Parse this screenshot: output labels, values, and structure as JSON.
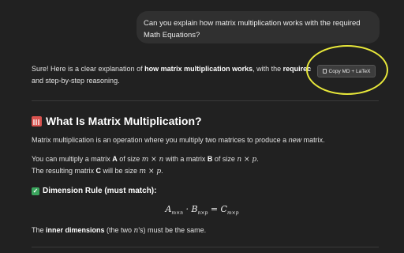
{
  "user_message": {
    "line1": "Can you explain how matrix multiplication works with the required",
    "line2": "Math Equations?"
  },
  "intro": {
    "pre": "Sure! Here is a clear explanation of ",
    "bold": "how matrix multiplication works",
    "mid": ", with the ",
    "bold2": "requirec",
    "line2": "and step-by-step reasoning."
  },
  "copy_button": {
    "label": "Copy MD + LaTeX"
  },
  "section": {
    "heading": "What Is Matrix Multiplication?",
    "definition_pre": "Matrix multiplication is an operation where you multiply two matrices to produce a ",
    "definition_em": "new",
    "definition_post": " matrix.",
    "line_a_1": "You can multiply a matrix ",
    "line_a_A": "A",
    "line_a_2": " of size ",
    "line_a_m1": "m × n",
    "line_a_3": " with a matrix ",
    "line_a_B": "B",
    "line_a_4": " of size ",
    "line_a_m2": "n × p",
    "line_a_5": ".",
    "line_b_1": "The resulting matrix ",
    "line_b_C": "C",
    "line_b_2": " will be size ",
    "line_b_m": "m × p",
    "line_b_3": "."
  },
  "rule": {
    "heading": "Dimension Rule (must match):",
    "formula_A": "A",
    "formula_A_sub": "m×n",
    "formula_dot": " · ",
    "formula_B": "B",
    "formula_B_sub": "n×p",
    "formula_eq": " = ",
    "formula_C": "C",
    "formula_C_sub": "m×p",
    "note_1": "The ",
    "note_bold": "inner dimensions",
    "note_2": " (the two ",
    "note_m": "n",
    "note_3": "'s) must be the same."
  },
  "colors": {
    "background": "#212121",
    "bubble": "#303030",
    "highlight": "#e8e83a"
  },
  "icons": [
    "calendar-icon",
    "check-mark-icon",
    "document-icon"
  ]
}
